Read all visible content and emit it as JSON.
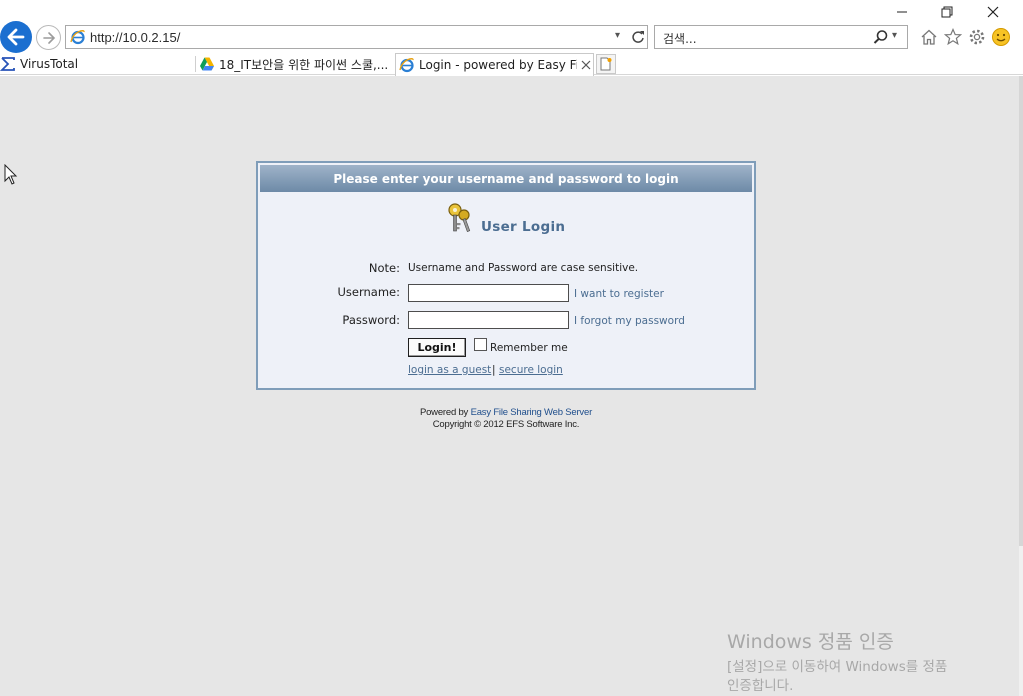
{
  "window": {
    "minimize_icon": "minimize-icon",
    "restore_icon": "restore-icon",
    "close_icon": "close-icon"
  },
  "toolbar": {
    "address_url": "http://10.0.2.15/",
    "search_placeholder": "검색...",
    "icons": [
      "back-arrow-icon",
      "forward-arrow-icon",
      "ie-logo-icon",
      "refresh-icon",
      "search-icon",
      "home-icon",
      "favorites-star-icon",
      "settings-gear-icon",
      "smiley-feedback-icon"
    ]
  },
  "tabs": [
    {
      "label": "VirusTotal",
      "icon": "sigma-icon"
    },
    {
      "label": "18_IT보안을 위한 파이썬 스쿨,...",
      "icon": "google-drive-icon"
    },
    {
      "label": "Login - powered by Easy Fi...",
      "icon": "ie-logo-icon",
      "active": true
    }
  ],
  "login": {
    "header": "Please enter your username and password to login",
    "title": "User Login",
    "note_label": "Note:",
    "note_text": "Username and Password are case sensitive.",
    "username_label": "Username:",
    "username_value": "",
    "password_label": "Password:",
    "password_value": "",
    "register_link": "I want to register",
    "forgot_link": "I forgot my password",
    "login_button": "Login!",
    "remember_label": "Remember me",
    "remember_checked": false,
    "guest_link": "login as a guest",
    "separator": "|",
    "secure_link": "secure login"
  },
  "footer": {
    "powered_prefix": "Powered by",
    "powered_link": "Easy File Sharing Web Server",
    "copyright": "Copyright © 2012 EFS Software Inc."
  },
  "watermark": {
    "line1": "Windows 정품 인증",
    "line2": "[설정]으로 이동하여 Windows를 정품",
    "line3": "인증합니다."
  },
  "colors": {
    "ie_blue": "#1b6fd0",
    "header_gradient_top": "#9fb3c9",
    "header_gradient_bottom": "#6d8aa7",
    "link_color": "#4b6d91",
    "box_border": "#7f9db9",
    "page_background": "#e6e6e6"
  }
}
